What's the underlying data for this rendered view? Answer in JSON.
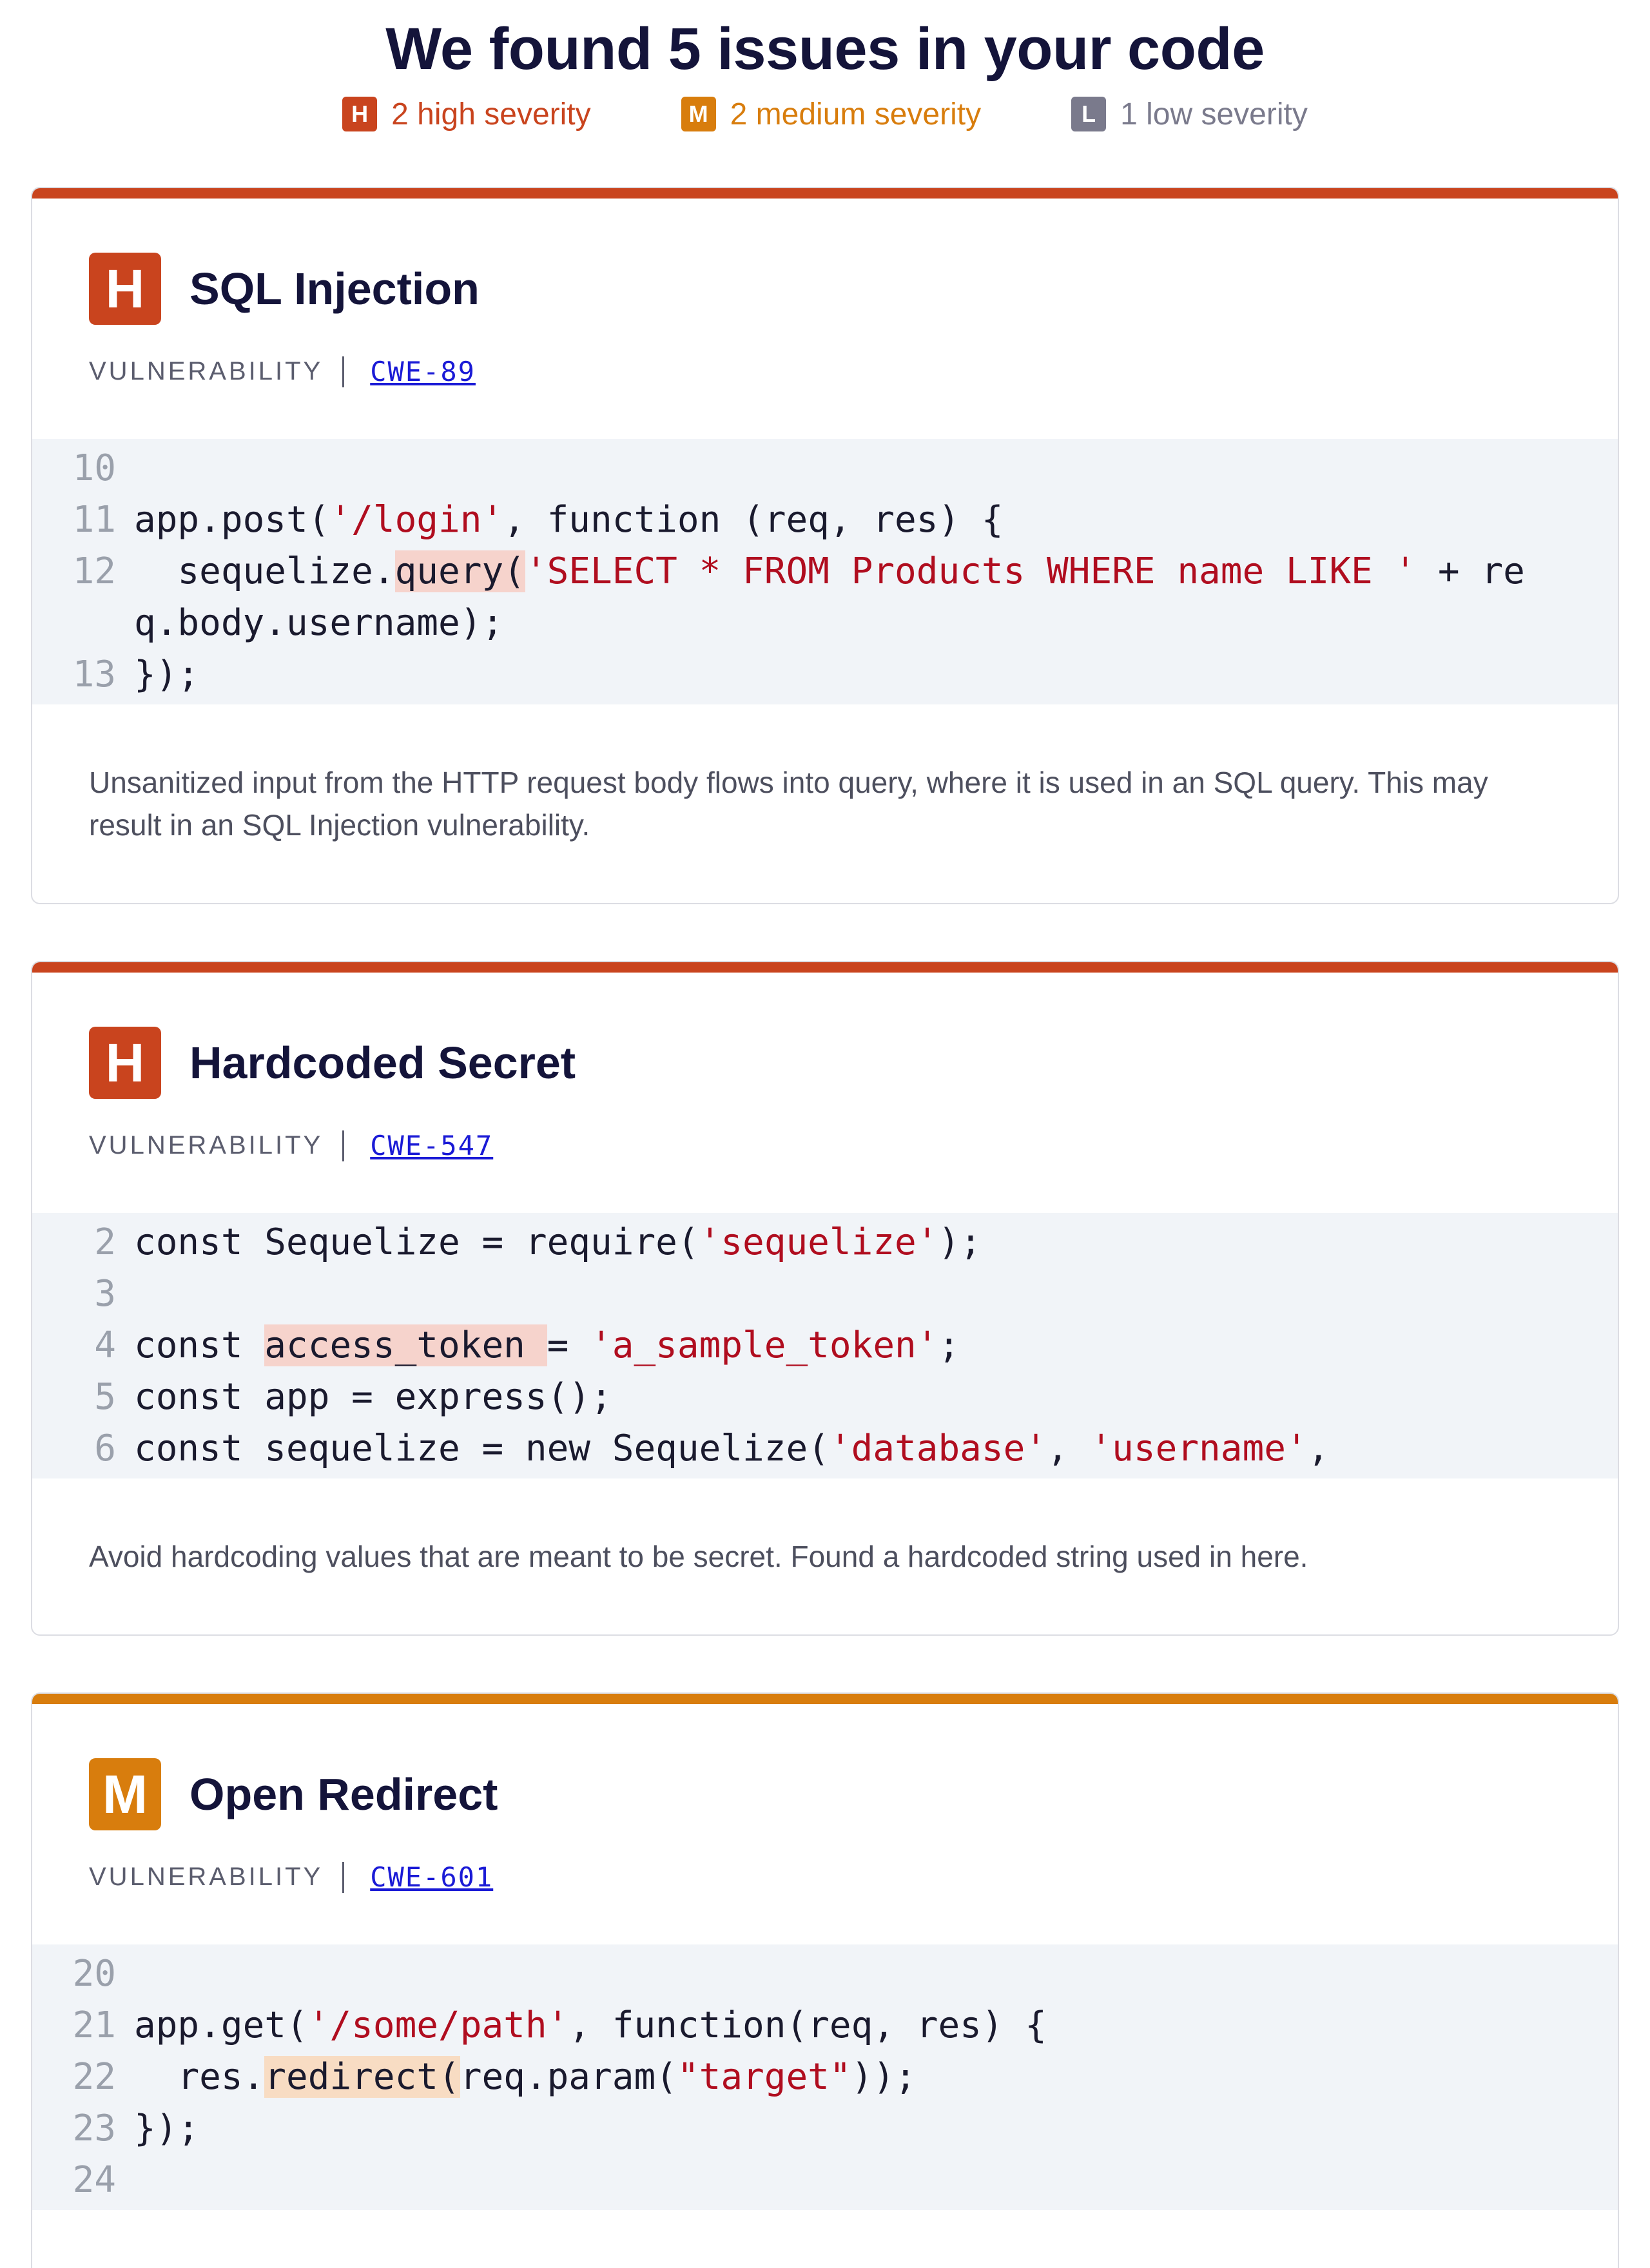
{
  "header": {
    "title": "We found 5 issues in your code",
    "summary": [
      {
        "letter": "H",
        "label": "2 high severity",
        "color": "#c9441e"
      },
      {
        "letter": "M",
        "label": "2 medium severity",
        "color": "#d87d0d"
      },
      {
        "letter": "L",
        "label": "1 low severity",
        "color": "#7a7a8c"
      }
    ]
  },
  "colors": {
    "high": "#c9441e",
    "medium": "#d87d0d",
    "low": "#7a7a8c"
  },
  "issues": [
    {
      "severity": "H",
      "title": "SQL Injection",
      "type": "VULNERABILITY",
      "cwe": "CWE-89",
      "code": [
        {
          "ln": "10",
          "parts": []
        },
        {
          "ln": "11",
          "parts": [
            {
              "t": "app.post("
            },
            {
              "t": "'/login'",
              "c": "str"
            },
            {
              "t": ", function (req, res) {"
            }
          ]
        },
        {
          "ln": "12",
          "parts": [
            {
              "t": "  sequelize."
            },
            {
              "t": "query(",
              "c": "hl-red"
            },
            {
              "t": "'SELECT * FROM Products WHERE name LIKE '",
              "c": "str"
            },
            {
              "t": " + req.body.username);"
            }
          ]
        },
        {
          "ln": "13",
          "parts": [
            {
              "t": "});"
            }
          ]
        }
      ],
      "description": "Unsanitized input from the HTTP request body flows into query, where it is used in an SQL query. This may result in an SQL Injection vulnerability."
    },
    {
      "severity": "H",
      "title": "Hardcoded Secret",
      "type": "VULNERABILITY",
      "cwe": "CWE-547",
      "code": [
        {
          "ln": "2",
          "parts": [
            {
              "t": "const Sequelize = require("
            },
            {
              "t": "'sequelize'",
              "c": "str"
            },
            {
              "t": ");"
            }
          ]
        },
        {
          "ln": "3",
          "parts": []
        },
        {
          "ln": "4",
          "parts": [
            {
              "t": "const "
            },
            {
              "t": "access_token ",
              "c": "hl-red"
            },
            {
              "t": "= "
            },
            {
              "t": "'a_sample_token'",
              "c": "str"
            },
            {
              "t": ";"
            }
          ]
        },
        {
          "ln": "5",
          "parts": [
            {
              "t": "const app = express();"
            }
          ]
        },
        {
          "ln": "6",
          "parts": [
            {
              "t": "const sequelize = new Sequelize("
            },
            {
              "t": "'database'",
              "c": "str"
            },
            {
              "t": ", "
            },
            {
              "t": "'username'",
              "c": "str"
            },
            {
              "t": ","
            }
          ]
        }
      ],
      "description": "Avoid hardcoding values that are meant to be secret. Found a hardcoded string used in here."
    },
    {
      "severity": "M",
      "title": "Open Redirect",
      "type": "VULNERABILITY",
      "cwe": "CWE-601",
      "code": [
        {
          "ln": "20",
          "parts": []
        },
        {
          "ln": "21",
          "parts": [
            {
              "t": "app.get("
            },
            {
              "t": "'/some/path'",
              "c": "str"
            },
            {
              "t": ", function(req, res) {"
            }
          ]
        },
        {
          "ln": "22",
          "parts": [
            {
              "t": "  res."
            },
            {
              "t": "redirect(",
              "c": "hl-orange"
            },
            {
              "t": "req.param("
            },
            {
              "t": "\"target\"",
              "c": "str"
            },
            {
              "t": "));"
            }
          ]
        },
        {
          "ln": "23",
          "parts": [
            {
              "t": "});"
            }
          ]
        },
        {
          "ln": "24",
          "parts": []
        }
      ],
      "description": ""
    }
  ]
}
